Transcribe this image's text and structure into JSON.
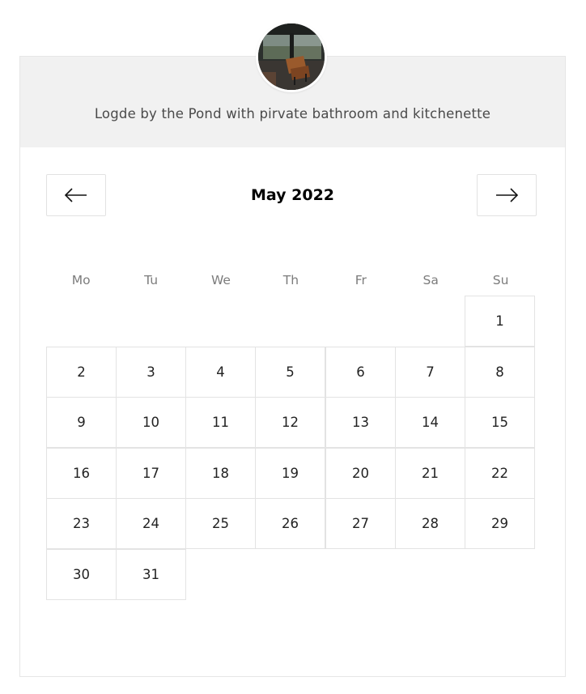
{
  "listing": {
    "title": "Logde by the Pond with pirvate bathroom and kitchenette"
  },
  "calendar": {
    "month_label": "May 2022",
    "prev_icon": "arrow-left-icon",
    "next_icon": "arrow-right-icon",
    "weekdays": [
      "Mo",
      "Tu",
      "We",
      "Th",
      "Fr",
      "Sa",
      "Su"
    ],
    "days": [
      "1",
      "2",
      "3",
      "4",
      "5",
      "6",
      "7",
      "8",
      "9",
      "10",
      "11",
      "12",
      "13",
      "14",
      "15",
      "16",
      "17",
      "18",
      "19",
      "20",
      "21",
      "22",
      "23",
      "24",
      "25",
      "26",
      "27",
      "28",
      "29",
      "30",
      "31"
    ]
  },
  "colors": {
    "header_bg": "#f1f1f1",
    "border": "#e3e3e3",
    "muted_text": "#7c7c7c"
  }
}
